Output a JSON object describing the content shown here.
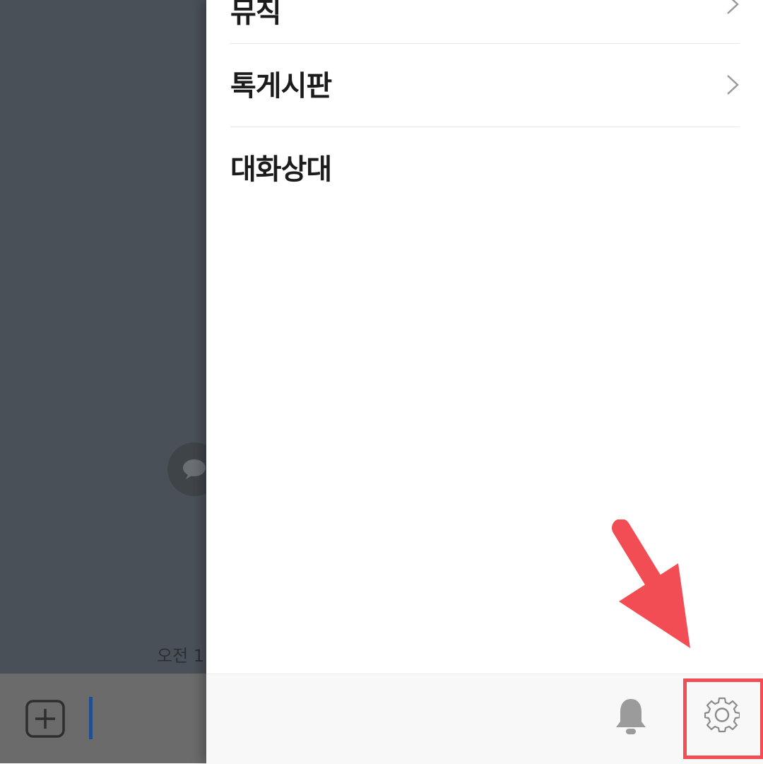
{
  "backdrop": {
    "timestamp": "오전 1"
  },
  "drawer": {
    "menu_items": [
      {
        "label": "뮤직"
      },
      {
        "label": "톡게시판"
      },
      {
        "label": "대화상대"
      }
    ]
  },
  "bottom_bar": {
    "icons": [
      "bell-icon",
      "gear-icon"
    ]
  },
  "annotation": {
    "color": "#f24d55"
  }
}
